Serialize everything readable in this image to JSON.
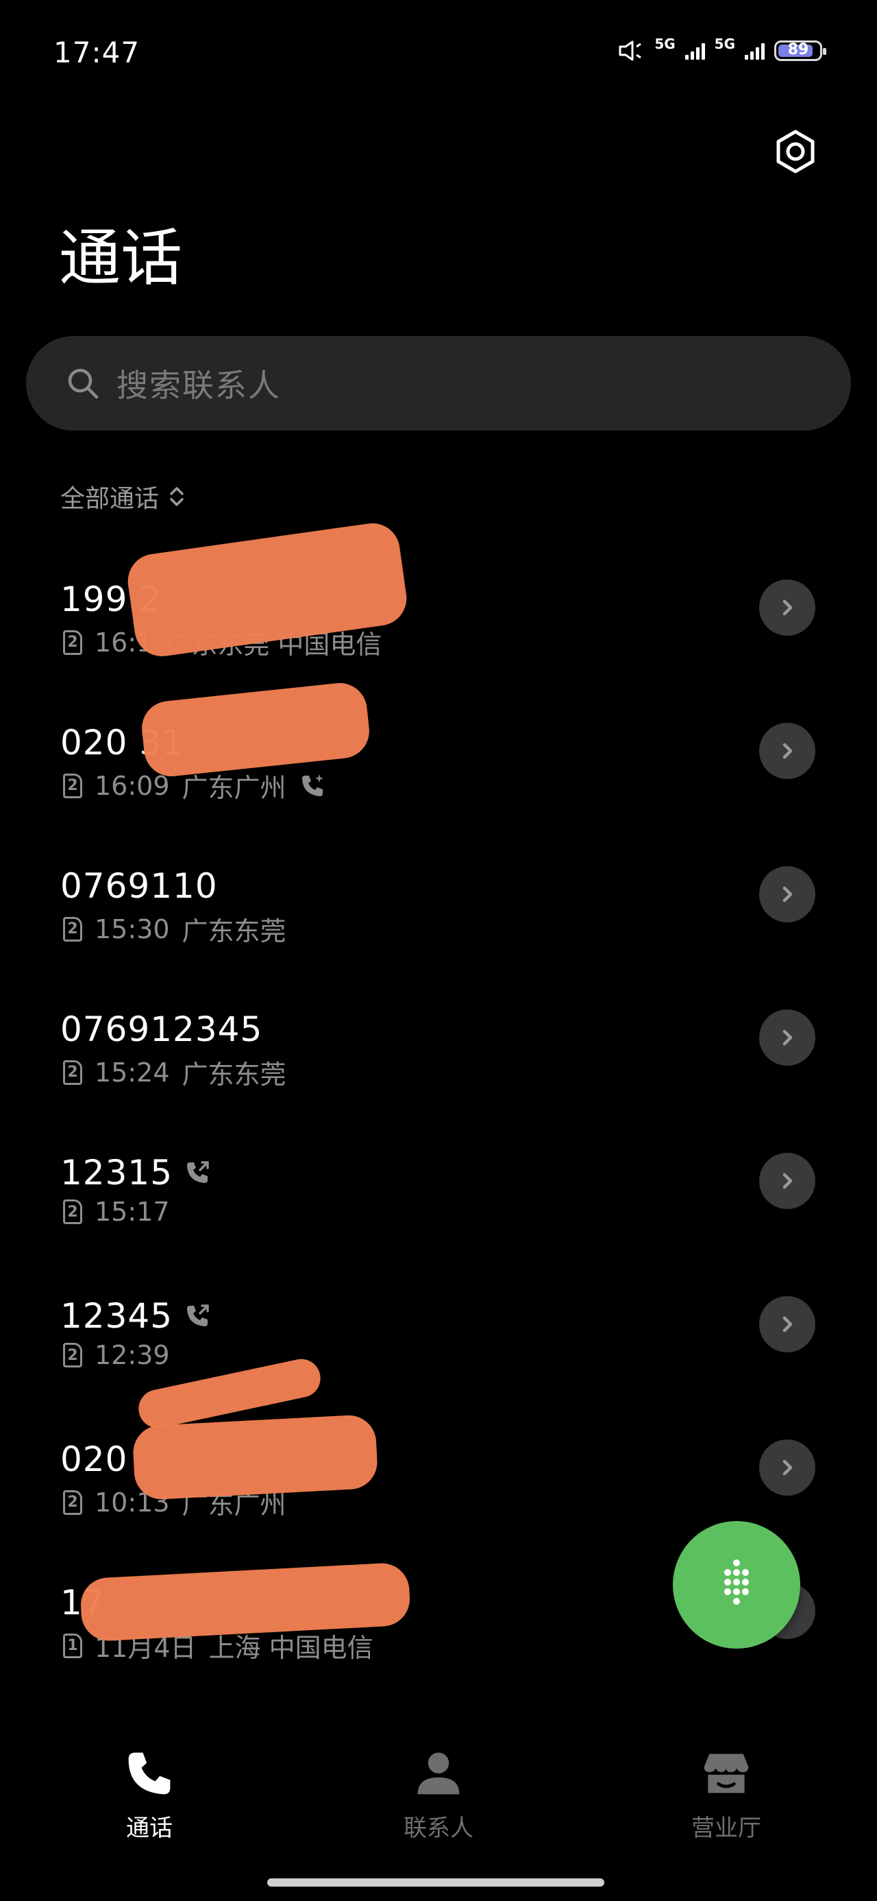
{
  "status_bar": {
    "time": "17:47",
    "network_1": "5G",
    "network_2": "5G",
    "battery": "89"
  },
  "header": {
    "title": "通话",
    "settings_icon": "settings-icon"
  },
  "search": {
    "placeholder": "搜索联系人"
  },
  "filter": {
    "label": "全部通话"
  },
  "calls": [
    {
      "number": "199 2",
      "sim": "2",
      "time": "16:1",
      "location": "广东东莞 中国电信",
      "call_icon": false
    },
    {
      "number": "020 31",
      "sim": "2",
      "time": "16:09",
      "location": "广东广州",
      "call_icon": true
    },
    {
      "number": "0769110",
      "sim": "2",
      "time": "15:30",
      "location": "广东东莞",
      "call_icon": false
    },
    {
      "number": "076912345",
      "sim": "2",
      "time": "15:24",
      "location": "广东东莞",
      "call_icon": false
    },
    {
      "number": "12315",
      "sim": "2",
      "time": "15:17",
      "location": "",
      "call_icon": true
    },
    {
      "number": "12345",
      "sim": "2",
      "time": "12:39",
      "location": "",
      "call_icon": true
    },
    {
      "number": "020",
      "sim": "2",
      "time": "10:13",
      "location": "广东广州",
      "call_icon": false
    },
    {
      "number": "17",
      "sim": "1",
      "time": "11月4日",
      "location": "上海 中国电信",
      "call_icon": false
    }
  ],
  "nav": {
    "calls": "通话",
    "contacts": "联系人",
    "hall": "营业厅"
  },
  "colors": {
    "accent_green": "#5cc05f",
    "redaction": "#ef7f52",
    "nav_active": "#ffffff",
    "nav_inactive": "#6e6e6e"
  }
}
